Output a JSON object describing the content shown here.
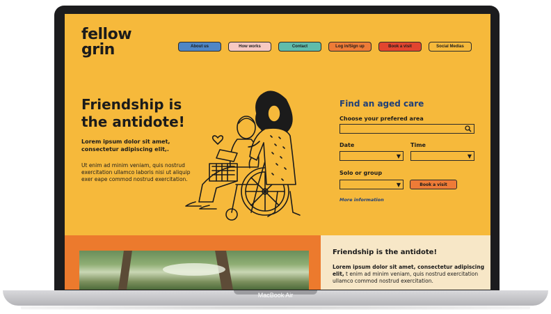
{
  "device": {
    "label": "MacBook Air"
  },
  "logo": {
    "line1": "fellow",
    "line2": "grin"
  },
  "nav": [
    {
      "label": "About us",
      "color": "#4f86c6"
    },
    {
      "label": "How works",
      "color": "#f7c9c2"
    },
    {
      "label": "Contact",
      "color": "#5fbcab"
    },
    {
      "label": "Log in/Sign up",
      "color": "#ee7b37"
    },
    {
      "label": "Book a visit",
      "color": "#e2452f"
    },
    {
      "label": "Social Medias",
      "color": "#f6b93b"
    }
  ],
  "hero": {
    "title": "Friendship is the antidote!",
    "subtitle": "Lorem ipsum dolor sit amet, consectetur adipiscing elit,.",
    "body": "Ut enim ad minim veniam, quis nostrud exercitation ullamco laboris nisi ut aliquip exer eape commod nostrud exercitation."
  },
  "form": {
    "title": "Find an aged care",
    "area_label": "Choose your prefered area",
    "date_label": "Date",
    "time_label": "Time",
    "solo_label": "Solo or group",
    "book_button": "Book a visit",
    "more_link": "More information"
  },
  "bottom": {
    "title": "Friendship is the antidote!",
    "body_bold": "Lorem ipsum dolor sit amet, consectetur adipiscing elit,",
    "body_rest": " t enim ad minim veniam, quis nostrud exercitation ullamco commod nostrud exercitation."
  },
  "colors": {
    "background": "#f6b93b",
    "accent_blue": "#1f3f78",
    "orange": "#ec7a2d",
    "cream": "#f7e7c7"
  }
}
